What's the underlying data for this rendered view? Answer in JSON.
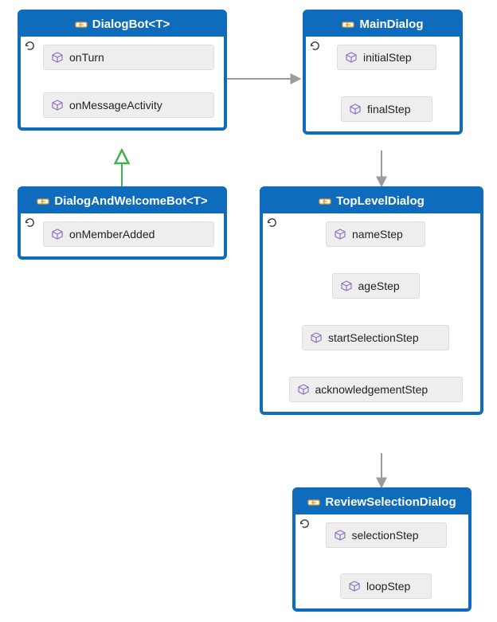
{
  "classes": {
    "dialogBot": {
      "title": "DialogBot<T>",
      "methods": [
        "onTurn",
        "onMessageActivity"
      ]
    },
    "mainDialog": {
      "title": "MainDialog",
      "methods": [
        "initialStep",
        "finalStep"
      ]
    },
    "dialogAndWelcomeBot": {
      "title": "DialogAndWelcomeBot<T>",
      "methods": [
        "onMemberAdded"
      ]
    },
    "topLevelDialog": {
      "title": "TopLevelDialog",
      "methods": [
        "nameStep",
        "ageStep",
        "startSelectionStep",
        "acknowledgementStep"
      ]
    },
    "reviewSelectionDialog": {
      "title": "ReviewSelectionDialog",
      "methods": [
        "selectionStep",
        "loopStep"
      ]
    }
  },
  "colors": {
    "primary": "#0f6cbd",
    "method_bg": "#eeeeee",
    "arrow": "#9b9b9b",
    "inheritance": "#3fb24f",
    "icon_accent": "#e19a2b",
    "cube": "#8e70c2"
  }
}
